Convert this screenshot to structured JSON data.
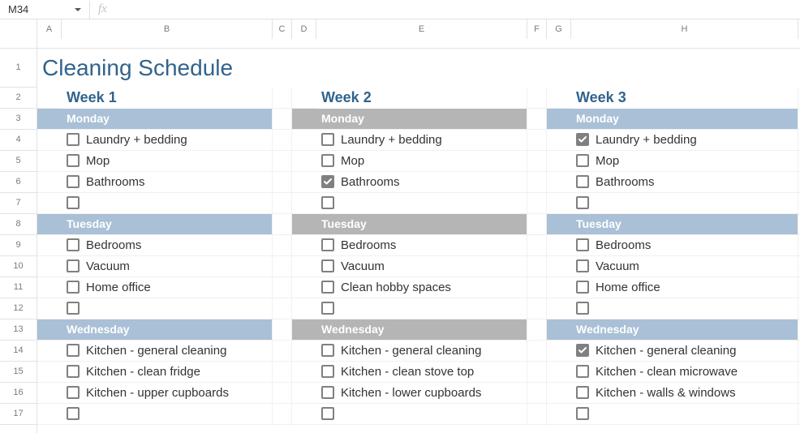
{
  "namebox": {
    "cell_ref": "M34",
    "fx_label": "fx"
  },
  "columns": [
    "A",
    "B",
    "C",
    "D",
    "E",
    "F",
    "G",
    "H",
    ""
  ],
  "rows": [
    "1",
    "2",
    "3",
    "4",
    "5",
    "6",
    "7",
    "8",
    "9",
    "10",
    "11",
    "12",
    "13",
    "14",
    "15",
    "16",
    "17"
  ],
  "title": "Cleaning Schedule",
  "weeks": [
    {
      "label": "Week 1",
      "muted": false,
      "days": [
        {
          "name": "Monday",
          "tasks": [
            {
              "text": "Laundry + bedding",
              "checked": false
            },
            {
              "text": "Mop",
              "checked": false
            },
            {
              "text": "Bathrooms",
              "checked": false
            },
            {
              "text": "",
              "checked": false
            }
          ]
        },
        {
          "name": "Tuesday",
          "tasks": [
            {
              "text": "Bedrooms",
              "checked": false
            },
            {
              "text": "Vacuum",
              "checked": false
            },
            {
              "text": "Home office",
              "checked": false
            },
            {
              "text": "",
              "checked": false
            }
          ]
        },
        {
          "name": "Wednesday",
          "tasks": [
            {
              "text": "Kitchen - general cleaning",
              "checked": false
            },
            {
              "text": "Kitchen - clean fridge",
              "checked": false
            },
            {
              "text": "Kitchen - upper cupboards",
              "checked": false
            },
            {
              "text": "",
              "checked": false
            }
          ]
        }
      ]
    },
    {
      "label": "Week 2",
      "muted": true,
      "days": [
        {
          "name": "Monday",
          "tasks": [
            {
              "text": "Laundry + bedding",
              "checked": false
            },
            {
              "text": "Mop",
              "checked": false
            },
            {
              "text": "Bathrooms",
              "checked": true
            },
            {
              "text": "",
              "checked": false
            }
          ]
        },
        {
          "name": "Tuesday",
          "tasks": [
            {
              "text": "Bedrooms",
              "checked": false
            },
            {
              "text": "Vacuum",
              "checked": false
            },
            {
              "text": "Clean hobby spaces",
              "checked": false
            },
            {
              "text": "",
              "checked": false
            }
          ]
        },
        {
          "name": "Wednesday",
          "tasks": [
            {
              "text": "Kitchen - general cleaning",
              "checked": false
            },
            {
              "text": "Kitchen - clean stove top",
              "checked": false
            },
            {
              "text": "Kitchen - lower cupboards",
              "checked": false
            },
            {
              "text": "",
              "checked": false
            }
          ]
        }
      ]
    },
    {
      "label": "Week 3",
      "muted": false,
      "days": [
        {
          "name": "Monday",
          "tasks": [
            {
              "text": "Laundry + bedding",
              "checked": true
            },
            {
              "text": "Mop",
              "checked": false
            },
            {
              "text": "Bathrooms",
              "checked": false
            },
            {
              "text": "",
              "checked": false
            }
          ]
        },
        {
          "name": "Tuesday",
          "tasks": [
            {
              "text": "Bedrooms",
              "checked": false
            },
            {
              "text": "Vacuum",
              "checked": false
            },
            {
              "text": "Home office",
              "checked": false
            },
            {
              "text": "",
              "checked": false
            }
          ]
        },
        {
          "name": "Wednesday",
          "tasks": [
            {
              "text": "Kitchen - general cleaning",
              "checked": true
            },
            {
              "text": "Kitchen - clean microwave",
              "checked": false
            },
            {
              "text": "Kitchen - walls & windows",
              "checked": false
            },
            {
              "text": "",
              "checked": false
            }
          ]
        }
      ]
    }
  ]
}
